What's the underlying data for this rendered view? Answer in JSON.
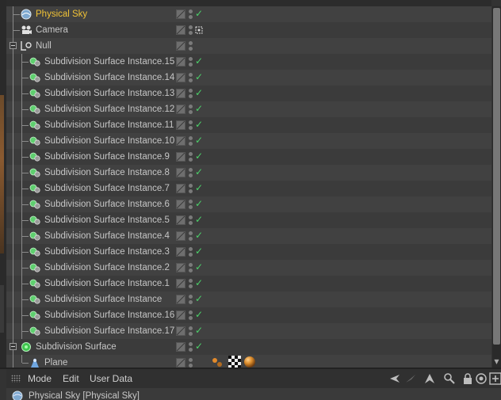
{
  "object_manager": {
    "objects": [
      {
        "name": "Physical Sky",
        "icon": "physical-sky-icon",
        "selected": true,
        "status": "check"
      },
      {
        "name": "Camera",
        "icon": "camera-icon",
        "selected": false,
        "status": "target"
      },
      {
        "name": "Null",
        "icon": "null-icon",
        "selected": false,
        "status": "none",
        "expanded": true
      },
      {
        "name": "Subdivision Surface Instance.15",
        "icon": "instance-icon",
        "status": "check"
      },
      {
        "name": "Subdivision Surface Instance.14",
        "icon": "instance-icon",
        "status": "check"
      },
      {
        "name": "Subdivision Surface Instance.13",
        "icon": "instance-icon",
        "status": "check"
      },
      {
        "name": "Subdivision Surface Instance.12",
        "icon": "instance-icon",
        "status": "check"
      },
      {
        "name": "Subdivision Surface Instance.11",
        "icon": "instance-icon",
        "status": "check"
      },
      {
        "name": "Subdivision Surface Instance.10",
        "icon": "instance-icon",
        "status": "check"
      },
      {
        "name": "Subdivision Surface Instance.9",
        "icon": "instance-icon",
        "status": "check"
      },
      {
        "name": "Subdivision Surface Instance.8",
        "icon": "instance-icon",
        "status": "check"
      },
      {
        "name": "Subdivision Surface Instance.7",
        "icon": "instance-icon",
        "status": "check"
      },
      {
        "name": "Subdivision Surface Instance.6",
        "icon": "instance-icon",
        "status": "check"
      },
      {
        "name": "Subdivision Surface Instance.5",
        "icon": "instance-icon",
        "status": "check"
      },
      {
        "name": "Subdivision Surface Instance.4",
        "icon": "instance-icon",
        "status": "check"
      },
      {
        "name": "Subdivision Surface Instance.3",
        "icon": "instance-icon",
        "status": "check"
      },
      {
        "name": "Subdivision Surface Instance.2",
        "icon": "instance-icon",
        "status": "check"
      },
      {
        "name": "Subdivision Surface Instance.1",
        "icon": "instance-icon",
        "status": "check"
      },
      {
        "name": "Subdivision Surface Instance",
        "icon": "instance-icon",
        "status": "check"
      },
      {
        "name": "Subdivision Surface Instance.16",
        "icon": "instance-icon",
        "status": "check"
      },
      {
        "name": "Subdivision Surface Instance.17",
        "icon": "instance-icon",
        "status": "check"
      },
      {
        "name": "Subdivision Surface",
        "icon": "subdivision-surface-icon",
        "status": "check",
        "expanded": true
      },
      {
        "name": "Plane",
        "icon": "plane-icon",
        "status": "none"
      }
    ],
    "colors": {
      "selected_text": "#f0c236",
      "check": "#4cd16a"
    }
  },
  "menubar": {
    "mode_label": "Mode",
    "edit_label": "Edit",
    "user_data_label": "User Data"
  },
  "attributes": {
    "title": "Physical Sky [Physical Sky]"
  }
}
